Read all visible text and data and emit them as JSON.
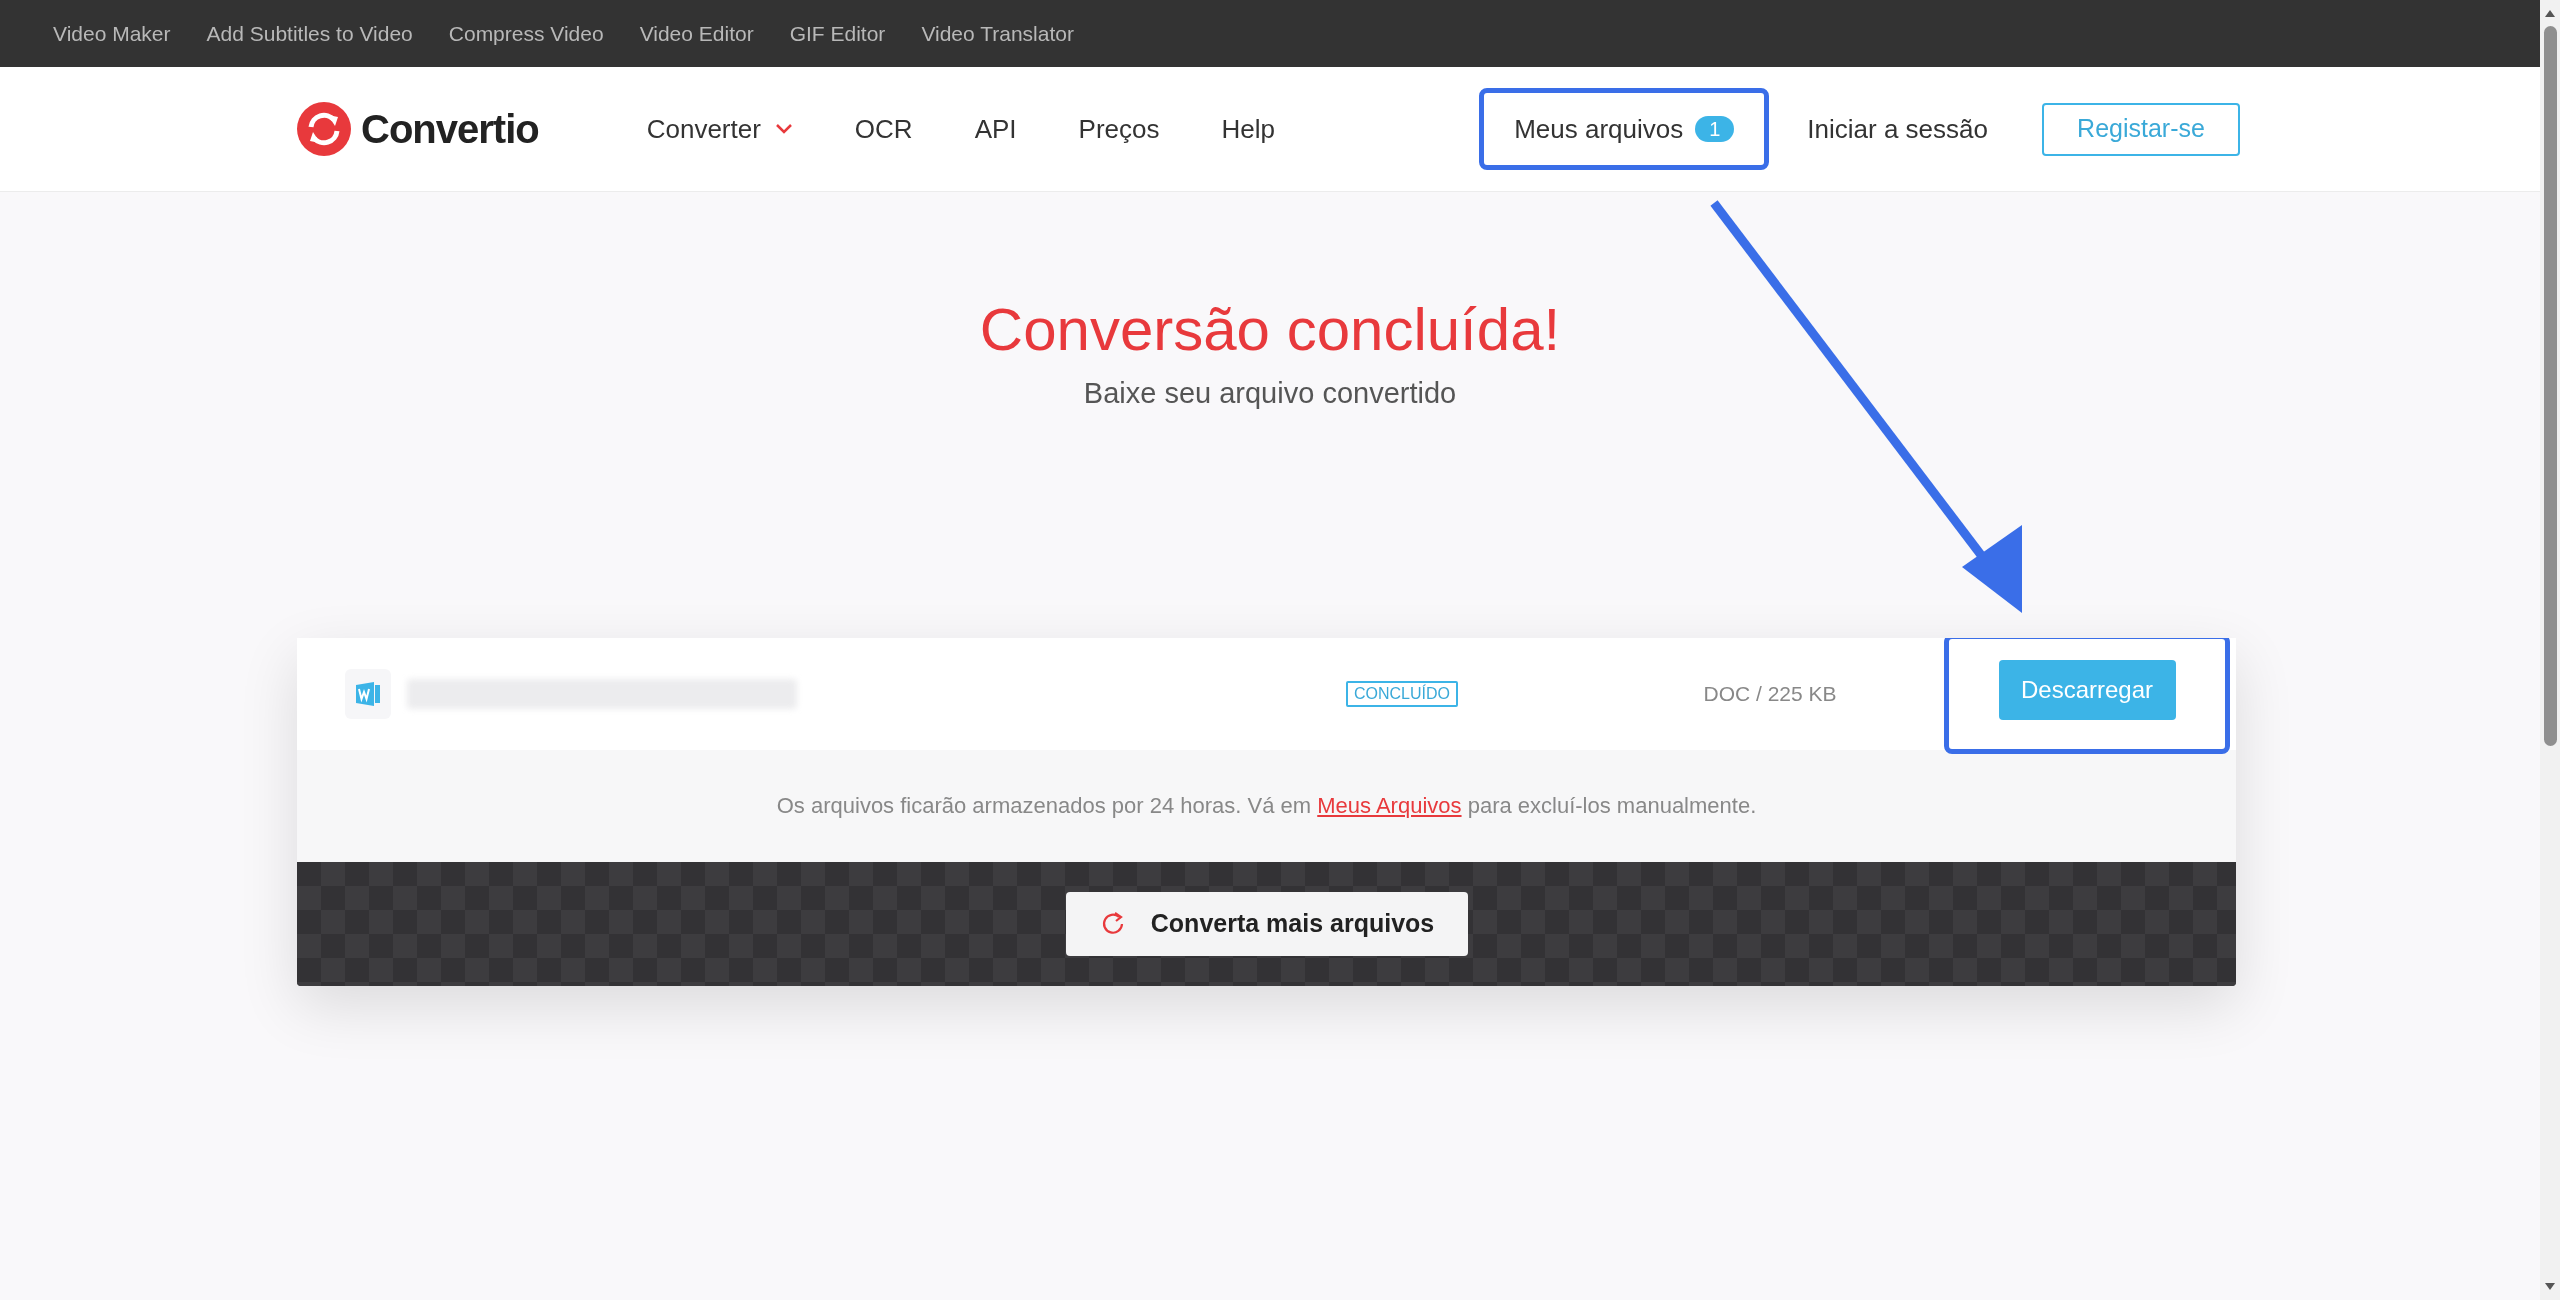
{
  "top_bar": {
    "links": [
      "Video Maker",
      "Add Subtitles to Video",
      "Compress Video",
      "Video Editor",
      "GIF Editor",
      "Video Translator"
    ]
  },
  "header": {
    "logo_text": "Convertio",
    "nav": [
      {
        "label": "Converter",
        "kind": "dropdown"
      },
      {
        "label": "OCR",
        "kind": "link"
      },
      {
        "label": "API",
        "kind": "link"
      },
      {
        "label": "Preços",
        "kind": "link"
      },
      {
        "label": "Help",
        "kind": "link"
      }
    ],
    "my_files": {
      "label": "Meus arquivos",
      "badge": "1",
      "highlighted": true
    },
    "login": "Iniciar a sessão",
    "signup": "Registar-se"
  },
  "hero": {
    "title": "Conversão concluída!",
    "subtitle": "Baixe seu arquivo convertido"
  },
  "files": [
    {
      "status": "CONCLUÍDO",
      "info": "DOC / 225 KB",
      "button": "Descarregar",
      "highlighted": true
    }
  ],
  "notice": {
    "before": "Os arquivos ficarão armazenados por 24 horas. Vá em",
    "link": "Meus Arquivos",
    "after": "para excluí-los manualmente."
  },
  "more_button": "Converta mais arquivos"
}
